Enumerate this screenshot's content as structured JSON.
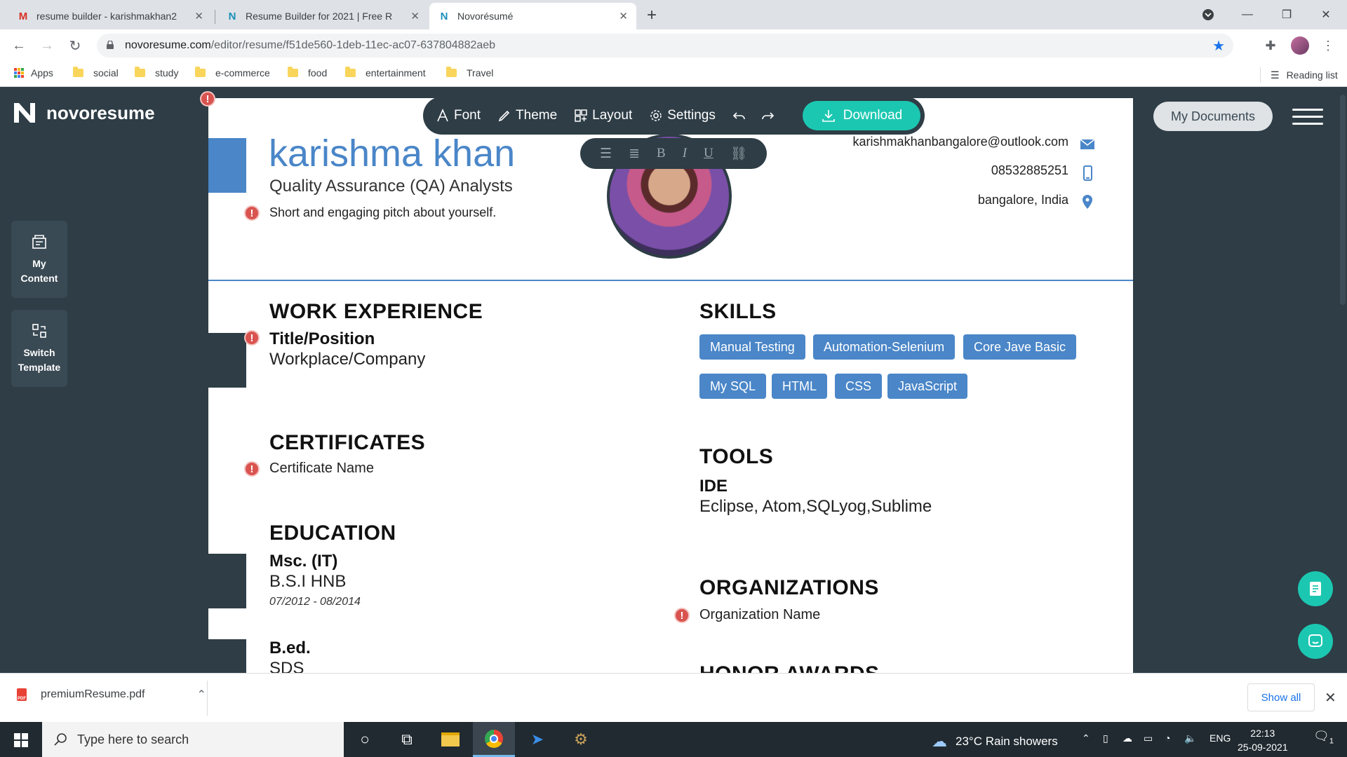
{
  "browser": {
    "tabs": [
      {
        "title": "resume builder - karishmakhan2",
        "favicon": "gmail-icon"
      },
      {
        "title": "Resume Builder for 2021 | Free R",
        "favicon": "novoresume-icon"
      },
      {
        "title": "Novorésumé",
        "favicon": "novoresume-icon"
      }
    ],
    "url_host": "novoresume.com",
    "url_path": "/editor/resume/f51de560-1deb-11ec-ac07-637804882aeb",
    "bookmarks": [
      "Apps",
      "social",
      "study",
      "e-commerce",
      "food",
      "entertainment",
      "Travel"
    ],
    "reading_list": "Reading list"
  },
  "app": {
    "brand": "novoresume",
    "side_buttons": [
      {
        "label_1": "My",
        "label_2": "Content",
        "icon": "my-content-icon"
      },
      {
        "label_1": "Switch",
        "label_2": "Template",
        "icon": "switch-template-icon"
      }
    ],
    "toolbar": {
      "font": "Font",
      "theme": "Theme",
      "layout": "Layout",
      "settings": "Settings",
      "download": "Download"
    },
    "format": {
      "bold": "B",
      "italic": "I",
      "underline": "U"
    },
    "my_documents": "My Documents",
    "accent_color": "#4a86c8",
    "download_color": "#1cc7b1"
  },
  "resume": {
    "name": "karishma khan",
    "role": "Quality Assurance (QA) Analysts",
    "pitch": "Short and engaging pitch about yourself.",
    "email": "karishmakhanbangalore@outlook.com",
    "phone": "08532885251",
    "location": "bangalore, India",
    "work": {
      "title": "WORK EXPERIENCE",
      "position": "Title/Position",
      "company": "Workplace/Company"
    },
    "certificates": {
      "title": "CERTIFICATES",
      "item": "Certificate Name"
    },
    "education": {
      "title": "EDUCATION",
      "items": [
        {
          "degree": "Msc. (IT)",
          "school": "B.S.I HNB",
          "dates": "07/2012 - 08/2014"
        },
        {
          "degree": "B.ed.",
          "school": "SDS"
        }
      ]
    },
    "skills": {
      "title": "SKILLS",
      "items": [
        "Manual Testing",
        "Automation-Selenium",
        "Core Jave Basic",
        "My SQL",
        "HTML",
        "CSS",
        "JavaScript"
      ]
    },
    "tools": {
      "title": "TOOLS",
      "subtitle": "IDE",
      "value": "Eclipse, Atom,SQLyog,Sublime"
    },
    "organizations": {
      "title": "ORGANIZATIONS",
      "item": "Organization Name"
    },
    "cut_heading": "HONOR AWARDS"
  },
  "downloads": {
    "file": "premiumResume.pdf",
    "show_all": "Show all"
  },
  "taskbar": {
    "search_placeholder": "Type here to search",
    "weather": "23°C  Rain showers",
    "language": "ENG",
    "time": "22:13",
    "date": "25-09-2021",
    "notifications": "1"
  }
}
